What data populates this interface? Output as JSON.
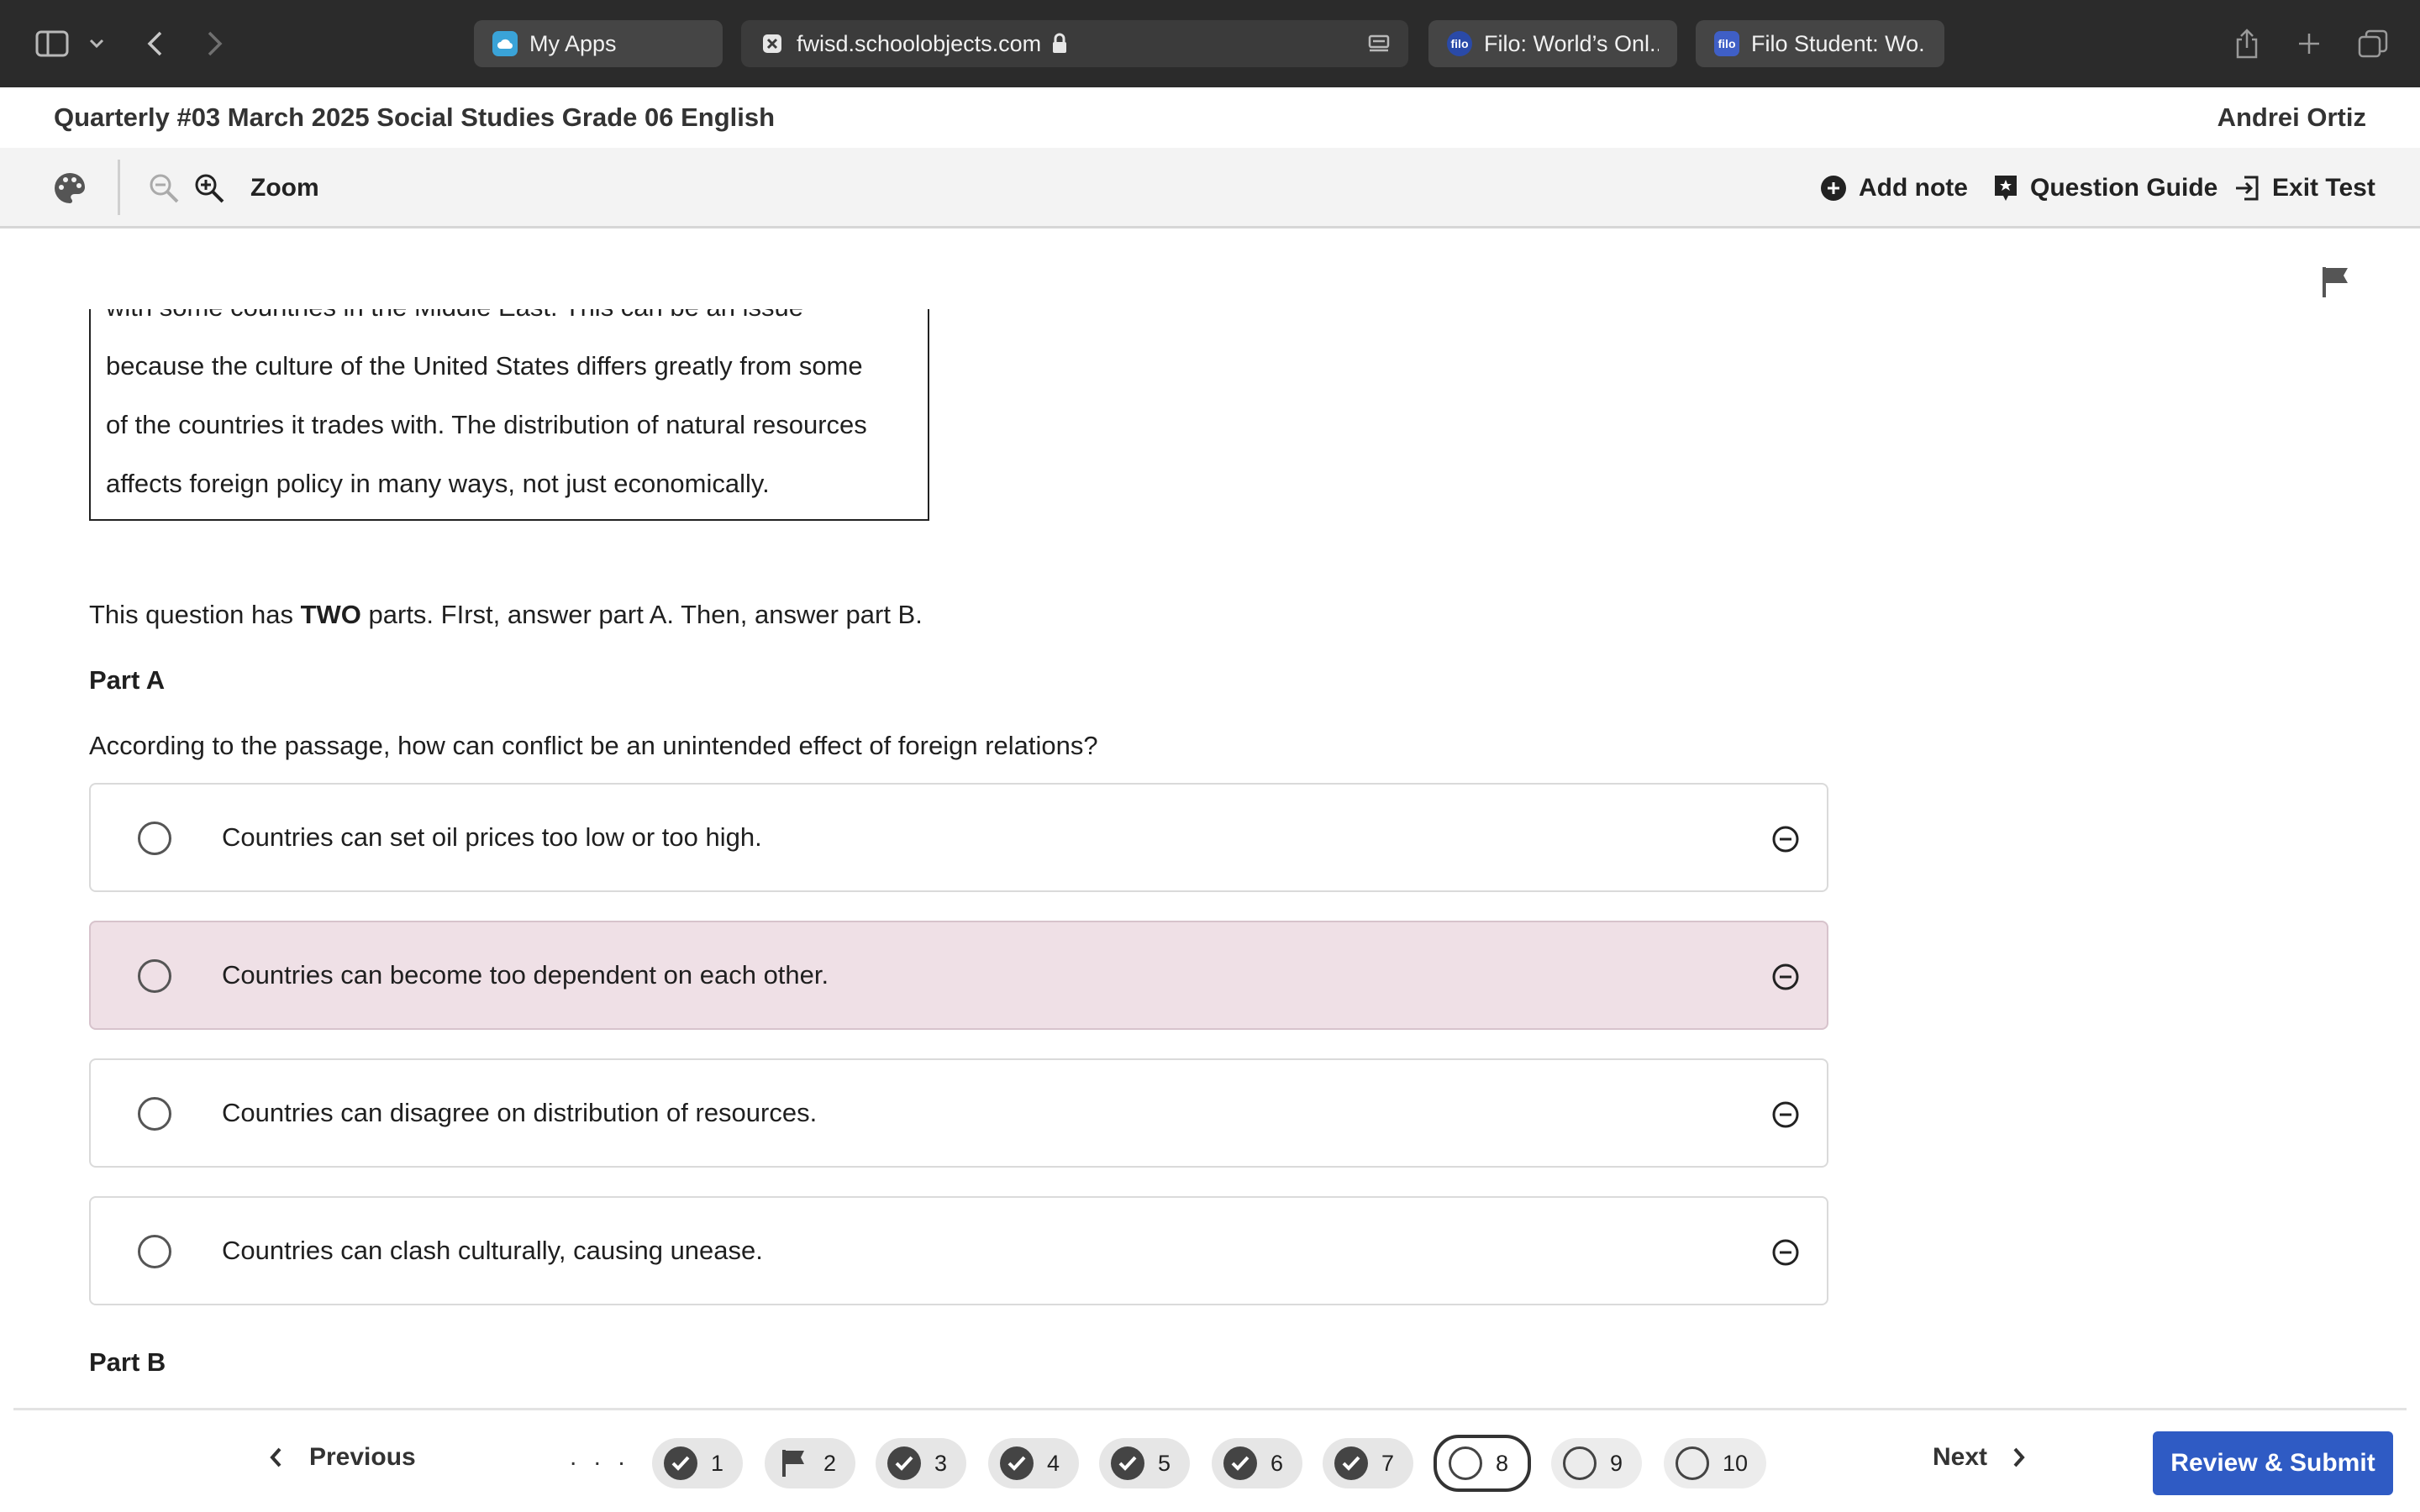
{
  "browser": {
    "tabs": [
      {
        "label": "My Apps",
        "icon": "cloud-app-icon"
      },
      {
        "label": "fwisd.schoolobjects.com",
        "icon": "close-tab-icon",
        "lock": "lock-icon"
      },
      {
        "label": "Filo: World’s Onl...",
        "icon": "filo-icon",
        "fav_text": "filo"
      },
      {
        "label": "Filo Student: Wo...",
        "icon": "filo-icon",
        "fav_text": "filo"
      }
    ]
  },
  "header": {
    "title": "Quarterly #03 March 2025 Social Studies Grade 06 English",
    "user": "Andrei Ortiz"
  },
  "toolbar": {
    "zoom_label": "Zoom",
    "add_note": "Add note",
    "question_guide": "Question Guide",
    "exit_test": "Exit Test"
  },
  "passage": {
    "cut_line": "with some countries in the Middle East. This can be an issue",
    "lines": [
      "because the culture of the United States differs greatly from some",
      "of the countries it trades with. The distribution of natural resources",
      "affects foreign policy in many ways, not just economically."
    ]
  },
  "question": {
    "intro_pre": "This question has ",
    "intro_bold": "TWO",
    "intro_post": " parts. FIrst, answer part A. Then, answer part B.",
    "part_a": "Part A",
    "prompt": "According to the passage, how can conflict be an unintended effect of foreign relations?",
    "choices": [
      {
        "text": "Countries can set oil prices too low or too high.",
        "highlighted": false
      },
      {
        "text": "Countries can become too dependent on each other.",
        "highlighted": true
      },
      {
        "text": "Countries can disagree on distribution of resources.",
        "highlighted": false
      },
      {
        "text": "Countries can clash culturally, causing unease.",
        "highlighted": false
      }
    ],
    "part_b": "Part B"
  },
  "navigation": {
    "previous": "Previous",
    "next": "Next",
    "ellipsis": ". . .",
    "review_submit": "Review & Submit",
    "questions": [
      {
        "num": "1",
        "state": "answered"
      },
      {
        "num": "2",
        "state": "flagged"
      },
      {
        "num": "3",
        "state": "answered"
      },
      {
        "num": "4",
        "state": "answered"
      },
      {
        "num": "5",
        "state": "answered"
      },
      {
        "num": "6",
        "state": "answered"
      },
      {
        "num": "7",
        "state": "answered"
      },
      {
        "num": "8",
        "state": "current"
      },
      {
        "num": "9",
        "state": "unanswered"
      },
      {
        "num": "10",
        "state": "unanswered"
      }
    ]
  },
  "colors": {
    "accent": "#2f5bc4",
    "highlight": "#efe0e6",
    "chrome": "#2b2b2b"
  }
}
